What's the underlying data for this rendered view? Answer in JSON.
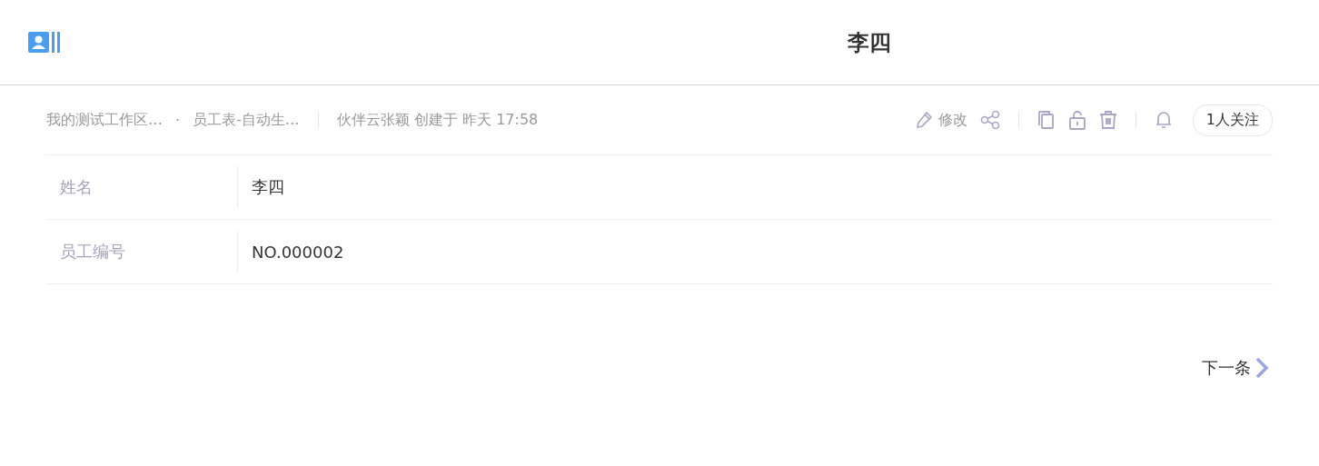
{
  "header": {
    "title": "李四"
  },
  "meta": {
    "breadcrumbs": [
      "我的测试工作区…",
      "员工表-自动生…"
    ],
    "separator": "·",
    "creator": "伙伴云张颖 创建于 昨天 17:58"
  },
  "actions": {
    "edit_label": "修改",
    "follow_label": "1人关注"
  },
  "fields": [
    {
      "label": "姓名",
      "value": "李四"
    },
    {
      "label": "员工编号",
      "value": "NO.000002"
    }
  ],
  "next_label": "下一条"
}
